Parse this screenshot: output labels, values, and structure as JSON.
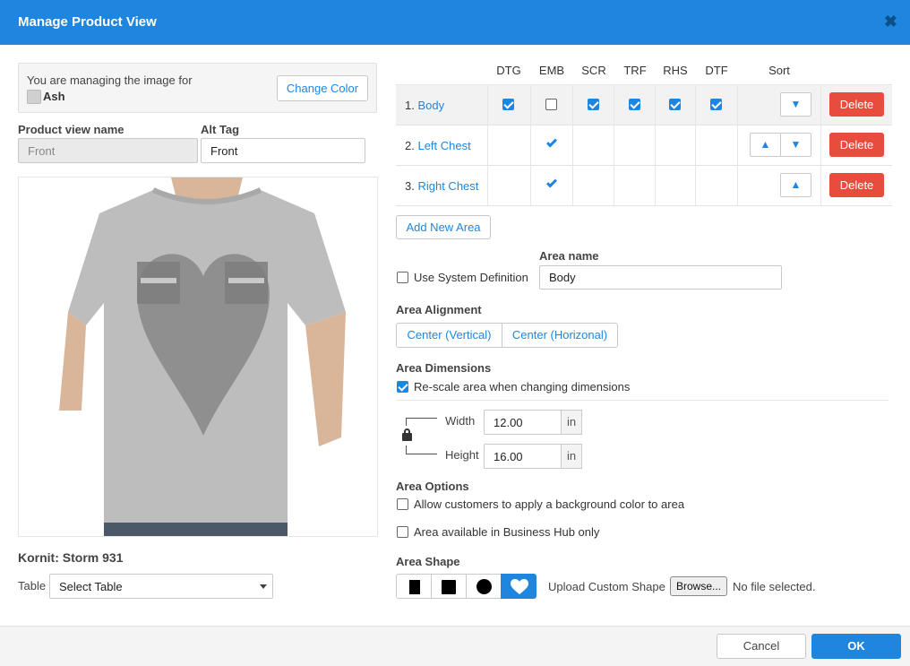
{
  "dialog": {
    "title": "Manage Product View",
    "close_glyph": "✖"
  },
  "left": {
    "managing_text": "You are managing the image for",
    "color_name": "Ash",
    "color_swatch": "#d0d0d0",
    "change_color_label": "Change Color",
    "view_name_label": "Product view name",
    "view_name_value": "Front",
    "alt_tag_label": "Alt Tag",
    "alt_tag_value": "Front",
    "printer_name": "Kornit: Storm 931",
    "table_label": "Table",
    "table_select_value": "Select Table",
    "shirt_color": "#bdbdbd",
    "area_tag": "Printable Surface"
  },
  "areas_table": {
    "columns": [
      "DTG",
      "EMB",
      "SCR",
      "TRF",
      "RHS",
      "DTF",
      "Sort"
    ],
    "rows": [
      {
        "index": "1.",
        "name": "Body",
        "checks": [
          true,
          false,
          true,
          true,
          true,
          true
        ],
        "delete_label": "Delete"
      },
      {
        "index": "2.",
        "name": "Left Chest",
        "checks": [
          false,
          true,
          false,
          false,
          false,
          false
        ],
        "delete_label": "Delete"
      },
      {
        "index": "3.",
        "name": "Right Chest",
        "checks": [
          false,
          true,
          false,
          false,
          false,
          false
        ],
        "delete_label": "Delete"
      }
    ],
    "up_glyph": "▲",
    "down_glyph": "▼",
    "add_area_label": "Add New Area"
  },
  "area_form": {
    "use_system_definition": "Use System Definition",
    "area_name_label": "Area name",
    "area_name_value": "Body",
    "alignment_label": "Area Alignment",
    "align_vertical": "Center (Vertical)",
    "align_horizontal": "Center (Horizonal)",
    "dimensions_label": "Area Dimensions",
    "rescale_label": "Re-scale area when changing dimensions",
    "width_label": "Width",
    "width_value": "12.00",
    "height_label": "Height",
    "height_value": "16.00",
    "unit": "in",
    "options_label": "Area Options",
    "option_bg_color": "Allow customers to apply a background color to area",
    "option_business_hub": "Area available in Business Hub only",
    "shape_label": "Area Shape",
    "upload_label": "Upload Custom Shape",
    "browse_label": "Browse...",
    "no_file_text": "No file selected."
  },
  "footer": {
    "cancel_label": "Cancel",
    "ok_label": "OK"
  },
  "colors": {
    "accent": "#1f86e0",
    "danger": "#e74c3c"
  }
}
